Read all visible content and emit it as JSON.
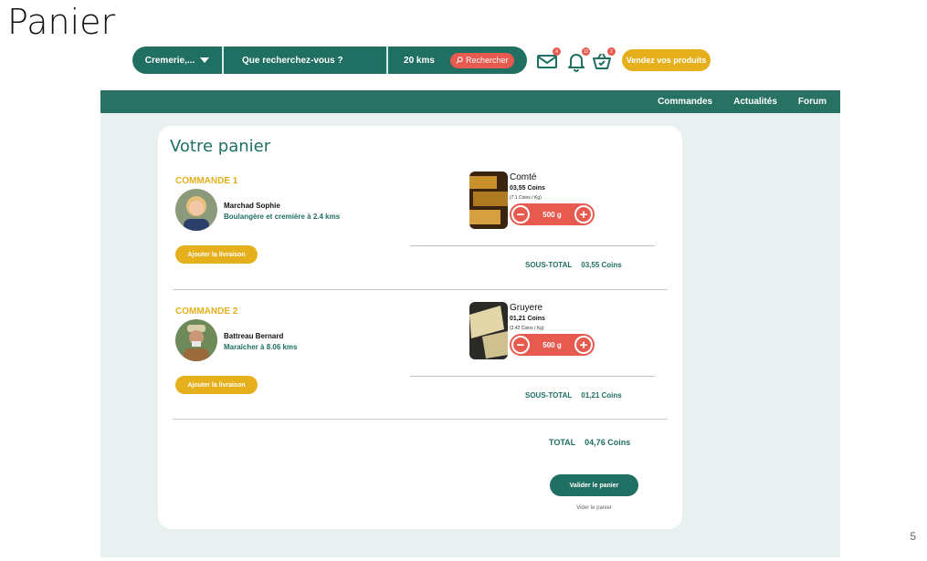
{
  "slide": {
    "title": "Panier",
    "page_number": "5"
  },
  "search": {
    "category": "Cremerie,...",
    "query": "Que recherchez-vous ?",
    "distance": "20 kms",
    "button": "Rechercher"
  },
  "header_icons": [
    {
      "name": "mail-icon",
      "badge": "4"
    },
    {
      "name": "bell-icon",
      "badge": "12"
    },
    {
      "name": "basket-icon",
      "badge": "2"
    }
  ],
  "sell_button": "Vendez vos produits",
  "nav": {
    "items": [
      "Commandes",
      "Actualités",
      "Forum"
    ]
  },
  "cart": {
    "title": "Votre panier",
    "subtotal_label": "SOUS-TOTAL",
    "delivery_button": "Ajouter la livraison",
    "orders": [
      {
        "label": "COMMANDE 1",
        "seller_name": "Marchad Sophie",
        "seller_desc": "Boulangère et cremière à 2.4 kms",
        "product": {
          "name": "Comté",
          "price": "03,55 Coins",
          "unit_price": "(7.1 Coins / Kg)",
          "quantity": "500 g"
        },
        "subtotal": "03,55 Coins"
      },
      {
        "label": "COMMANDE 2",
        "seller_name": "Battreau Bernard",
        "seller_desc": "Maraîcher à 8.06 kms",
        "product": {
          "name": "Gruyere",
          "price": "01,21 Coins",
          "unit_price": "(2.42 Coins / Kg)",
          "quantity": "500 g"
        },
        "subtotal": "01,21 Coins"
      }
    ],
    "total_label": "TOTAL",
    "total": "04,76 Coins",
    "validate_button": "Valider le panier",
    "validate_caption": "Vider le panier"
  },
  "colors": {
    "primary": "#1f6f62",
    "nav": "#287263",
    "accent": "#e5b01c",
    "danger": "#e65a4f",
    "background": "#e8f1ef"
  }
}
